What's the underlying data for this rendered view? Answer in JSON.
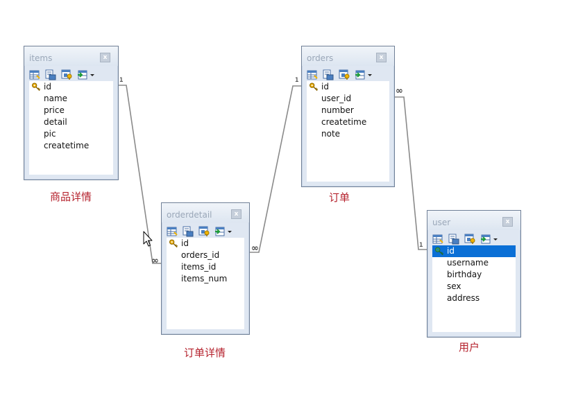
{
  "tables": {
    "items": {
      "title": "items",
      "close": "x",
      "caption": "商品详情",
      "fields": [
        "id",
        "name",
        "price",
        "detail",
        "pic",
        "createtime"
      ]
    },
    "orderdetail": {
      "title": "orderdetail",
      "close": "x",
      "caption": "订单详情",
      "fields": [
        "id",
        "orders_id",
        "items_id",
        "items_num"
      ]
    },
    "orders": {
      "title": "orders",
      "close": "x",
      "caption": "订单",
      "fields": [
        "id",
        "user_id",
        "number",
        "createtime",
        "note"
      ]
    },
    "user": {
      "title": "user",
      "close": "x",
      "caption": "用户",
      "fields": [
        "id",
        "username",
        "birthday",
        "sex",
        "address"
      ],
      "selected_field": "id"
    }
  },
  "relations": {
    "items_orderdetail": {
      "one": "1",
      "many": "∞"
    },
    "orders_orderdetail": {
      "one": "1",
      "many": "∞"
    },
    "user_orders": {
      "one": "1",
      "many": "∞"
    }
  },
  "colors": {
    "caption": "#b5222d",
    "selection": "#0a6fd6",
    "connector": "#888888"
  }
}
